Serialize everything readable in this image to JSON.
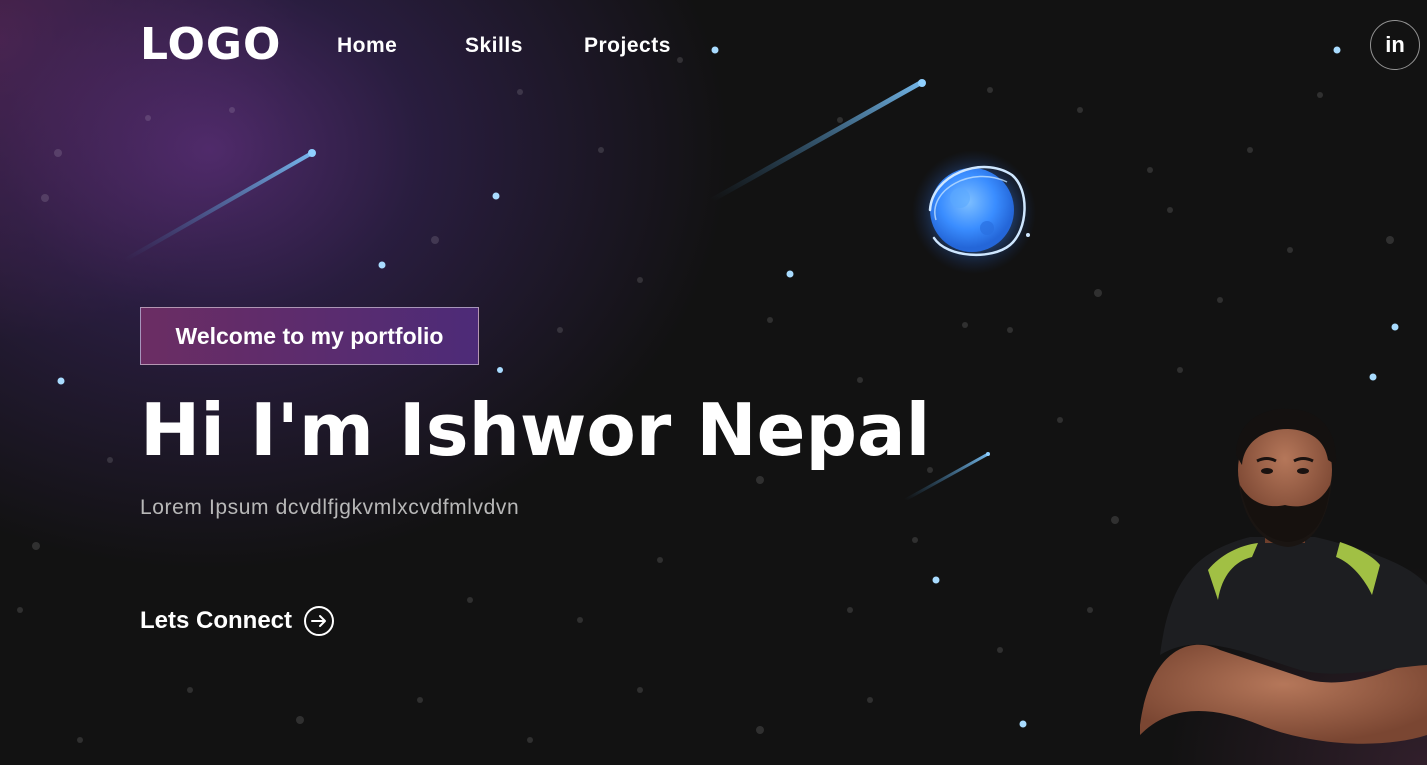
{
  "nav": {
    "logo": "LOGO",
    "links": [
      "Home",
      "Skills",
      "Projects"
    ],
    "social_icon": "linkedin-icon",
    "social_label": "in"
  },
  "hero": {
    "tagline": "Welcome to my portfolio",
    "title": "Hi I'm Ishwor Nepal",
    "description": "Lorem Ipsum dcvdlfjgkvmlxcvdfmlvdvn",
    "cta_label": "Lets Connect",
    "cta_icon": "arrow-right-circle-icon"
  },
  "colors": {
    "background": "#121212",
    "tagline_gradient_start": "#6b2d63",
    "tagline_gradient_end": "#4d2b78",
    "description_text": "#b8b8b8",
    "planet": "#3d8bff",
    "star": "#a9dcff"
  },
  "illustrations": [
    "planet-illustration",
    "shooting-stars",
    "starfield",
    "portrait-photo"
  ]
}
